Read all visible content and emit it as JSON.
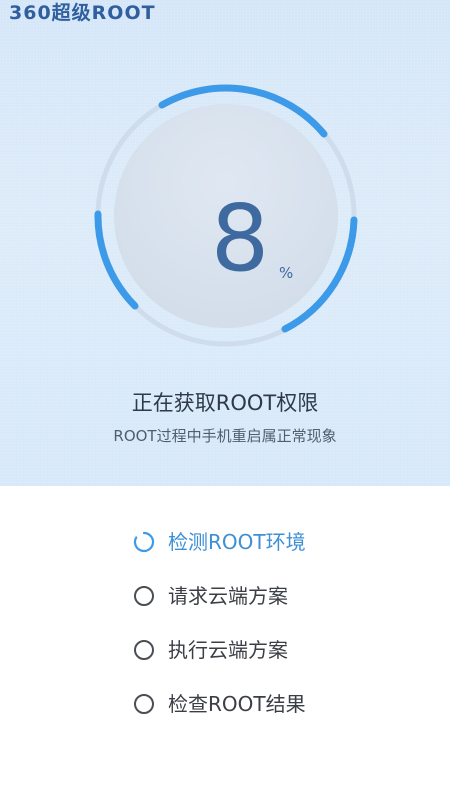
{
  "app": {
    "logo_text": "360超级ROOT"
  },
  "progress": {
    "value": "8",
    "unit": "%",
    "fraction": 0.08
  },
  "status": {
    "title": "正在获取ROOT权限",
    "subtitle": "ROOT过程中手机重启属正常现象"
  },
  "steps": [
    {
      "label": "检测ROOT环境",
      "state": "in-progress"
    },
    {
      "label": "请求云端方案",
      "state": "pending"
    },
    {
      "label": "执行云端方案",
      "state": "pending"
    },
    {
      "label": "检查ROOT结果",
      "state": "pending"
    }
  ],
  "colors": {
    "accent": "#3d9ae8",
    "ring_track": "#cfdceb",
    "digit": "#3e6aa0",
    "hero_bg": "#d6e8fa"
  }
}
